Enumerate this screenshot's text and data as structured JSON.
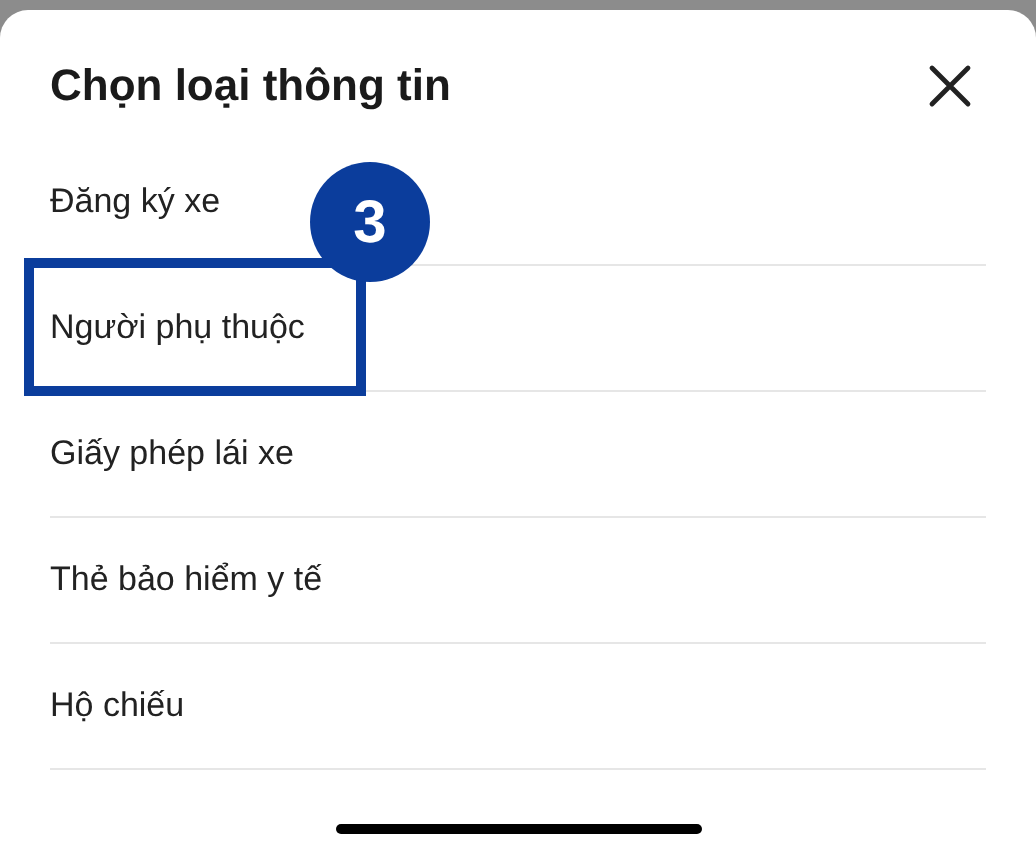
{
  "sheet": {
    "title": "Chọn loại thông tin"
  },
  "items": [
    {
      "label": "Đăng ký xe",
      "highlighted": false
    },
    {
      "label": "Người phụ thuộc",
      "highlighted": true,
      "callout": "3"
    },
    {
      "label": "Giấy phép lái xe",
      "highlighted": false
    },
    {
      "label": "Thẻ bảo hiểm y tế",
      "highlighted": false
    },
    {
      "label": "Hộ chiếu",
      "highlighted": false
    }
  ]
}
